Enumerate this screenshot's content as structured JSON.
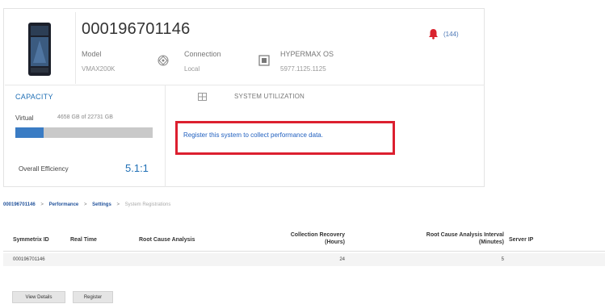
{
  "system": {
    "id": "000196701146",
    "alert_count": "(144)",
    "model_label": "Model",
    "model_value": "VMAX200K",
    "connection_label": "Connection",
    "connection_value": "Local",
    "os_label": "HYPERMAX OS",
    "os_value": "5977.1125.1125"
  },
  "capacity": {
    "title": "CAPACITY",
    "virtual_label": "Virtual",
    "virtual_value": "4658 GB of 22731 GB",
    "used_fraction": 0.205,
    "efficiency_label": "Overall Efficiency",
    "efficiency_value": "5.1:1"
  },
  "utilization": {
    "title": "SYSTEM UTILIZATION",
    "register_link": "Register this system to collect performance data."
  },
  "breadcrumb": {
    "system": "000196701146",
    "performance": "Performance",
    "settings": "Settings",
    "current": "System Registrations"
  },
  "table": {
    "headers": {
      "symmetrix_id": "Symmetrix ID",
      "real_time": "Real Time",
      "root_cause": "Root Cause Analysis",
      "collection_recovery": "Collection Recovery",
      "collection_recovery_unit": "(Hours)",
      "rca_interval": "Root Cause Analysis Interval",
      "rca_interval_unit": "(Minutes)",
      "server_ip": "Server IP"
    },
    "rows": [
      {
        "symmetrix_id": "000196701146",
        "real_time": "",
        "root_cause": "",
        "collection_recovery": "24",
        "rca_interval": "5",
        "server_ip": ""
      }
    ]
  },
  "buttons": {
    "view_details": "View Details",
    "register": "Register"
  },
  "colors": {
    "accent": "#1f6fb5",
    "alert": "#d9232e",
    "highlight_box": "#dc1f2f"
  },
  "icons": {
    "device": "storage-array-icon",
    "connection": "connection-target-icon",
    "os": "os-chip-icon",
    "alert": "bell-icon",
    "utilization": "chart-grid-icon"
  }
}
